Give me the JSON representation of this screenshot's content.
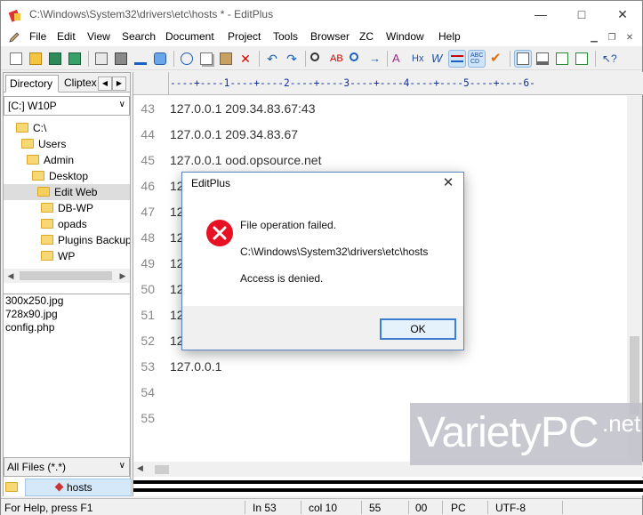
{
  "window": {
    "title": "C:\\Windows\\System32\\drivers\\etc\\hosts * - EditPlus",
    "controls": [
      "minimize",
      "maximize",
      "close"
    ]
  },
  "menu": {
    "items": [
      "File",
      "Edit",
      "View",
      "Search",
      "Document",
      "Project",
      "Tools",
      "Browser",
      "ZC",
      "Window",
      "Help"
    ]
  },
  "toolbar": {
    "icons": [
      "new-file-icon",
      "open-folder-icon",
      "save-icon",
      "save-all-icon",
      "print-preview-icon",
      "print-icon",
      "spellcheck-icon",
      "browser-icon",
      "cut-icon",
      "copy-icon",
      "paste-icon",
      "delete-icon",
      "undo-icon",
      "redo-icon",
      "find-icon",
      "replace-icon",
      "find-in-files-icon",
      "goto-icon",
      "font-icon",
      "hex-icon",
      "word-wrap-icon",
      "ruler-icon",
      "line-number-icon",
      "check-icon",
      "directory-window-icon",
      "output-window-icon",
      "clip-icon",
      "fullscreen-icon",
      "help-icon"
    ]
  },
  "sidebar": {
    "tabs": [
      "Directory",
      "Cliptex"
    ],
    "drive": "[C:] W10P",
    "tree": [
      {
        "label": "C:\\",
        "indent": 0,
        "selected": false
      },
      {
        "label": "Users",
        "indent": 1,
        "selected": false
      },
      {
        "label": "Admin",
        "indent": 2,
        "selected": false
      },
      {
        "label": "Desktop",
        "indent": 3,
        "selected": false
      },
      {
        "label": "Edit Web",
        "indent": 4,
        "selected": true
      },
      {
        "label": "DB-WP",
        "indent": 5,
        "selected": false
      },
      {
        "label": "opads",
        "indent": 5,
        "selected": false
      },
      {
        "label": "Plugins Backup",
        "indent": 5,
        "selected": false
      },
      {
        "label": "WP",
        "indent": 5,
        "selected": false
      }
    ],
    "files": [
      "300x250.jpg",
      "728x90.jpg",
      "config.php"
    ],
    "filter": "All Files (*.*)",
    "open_doc": "hosts"
  },
  "editor": {
    "ruler": "----+----1----+----2----+----3----+----4----+----5----+----6-",
    "lines": [
      {
        "num": "43",
        "text": "127.0.0.1 209.34.83.67:43"
      },
      {
        "num": "44",
        "text": "127.0.0.1 209.34.83.67"
      },
      {
        "num": "45",
        "text": "127.0.0.1 ood.opsource.net"
      },
      {
        "num": "46",
        "text": "127"
      },
      {
        "num": "47",
        "text": "127"
      },
      {
        "num": "48",
        "text": "127"
      },
      {
        "num": "49",
        "text": "127"
      },
      {
        "num": "50",
        "text": "127"
      },
      {
        "num": "51",
        "text": "127"
      },
      {
        "num": "52",
        "text": "127"
      },
      {
        "num": "53",
        "text": "127.0.0.1"
      },
      {
        "num": "54",
        "text": ""
      },
      {
        "num": "55",
        "text": ""
      }
    ]
  },
  "dialog": {
    "title": "EditPlus",
    "message": "File operation failed.",
    "path": "C:\\Windows\\System32\\drivers\\etc\\hosts",
    "detail": "Access is denied.",
    "ok_label": "OK"
  },
  "status": {
    "help": "For Help, press F1",
    "line": "In 53",
    "col": "col 10",
    "total": "55",
    "sel": "00",
    "mode": "PC",
    "encoding": "UTF-8"
  },
  "watermark": {
    "text": "VarietyPC",
    "suffix": ".net"
  },
  "colors": {
    "error_red": "#e81123",
    "accent": "#3c7fd1",
    "selection": "#cde3f7"
  }
}
